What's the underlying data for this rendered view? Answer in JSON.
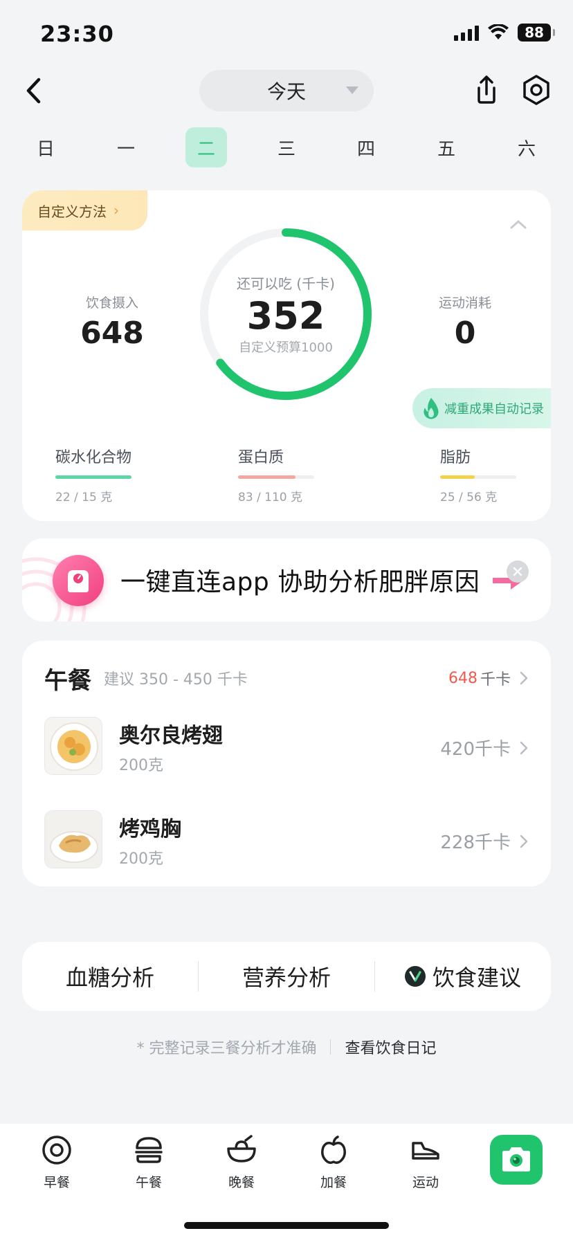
{
  "status": {
    "time": "23:30",
    "battery": "88"
  },
  "nav": {
    "date_label": "今天"
  },
  "week": {
    "days": [
      "日",
      "一",
      "二",
      "三",
      "四",
      "五",
      "六"
    ],
    "active_index": 2
  },
  "summary": {
    "custom_method_label": "自定义方法",
    "intake_label": "饮食摄入",
    "intake_value": "648",
    "remaining_label": "还可以吃 (千卡)",
    "remaining_value": "352",
    "budget_label": "自定义预算1000",
    "budget_progress": 0.648,
    "exercise_label": "运动消耗",
    "exercise_value": "0",
    "auto_record_label": "减重成果自动记录",
    "macros": [
      {
        "name": "碳水化合物",
        "amount": "22 / 15 克",
        "progress": 1.0,
        "color": "#5dd6a3"
      },
      {
        "name": "蛋白质",
        "amount": "83 / 110 克",
        "progress": 0.75,
        "color": "#f6a6a0"
      },
      {
        "name": "脂肪",
        "amount": "25 / 56 克",
        "progress": 0.45,
        "color": "#f5d04a"
      }
    ]
  },
  "banner": {
    "text": "一键直连app 协助分析肥胖原因"
  },
  "meal": {
    "title": "午餐",
    "suggestion": "建议 350 - 450 千卡",
    "total_value": "648",
    "total_unit": "千卡",
    "foods": [
      {
        "name": "奥尔良烤翅",
        "qty": "200克",
        "kcal": "420千卡"
      },
      {
        "name": "烤鸡胸",
        "qty": "200克",
        "kcal": "228千卡"
      }
    ]
  },
  "analysis": {
    "blood_sugar": "血糖分析",
    "nutrition": "营养分析",
    "advice": "饮食建议"
  },
  "footnote": {
    "note": "* 完整记录三餐分析才准确",
    "link": "查看饮食日记"
  },
  "tabs": [
    {
      "label": "早餐",
      "icon": "breakfast-icon"
    },
    {
      "label": "午餐",
      "icon": "burger-icon"
    },
    {
      "label": "晚餐",
      "icon": "bowl-icon"
    },
    {
      "label": "加餐",
      "icon": "apple-icon"
    },
    {
      "label": "运动",
      "icon": "sneaker-icon"
    }
  ],
  "colors": {
    "accent": "#20c46d",
    "ring_track": "#f1f2f4",
    "over_budget": "#f05a4e"
  }
}
